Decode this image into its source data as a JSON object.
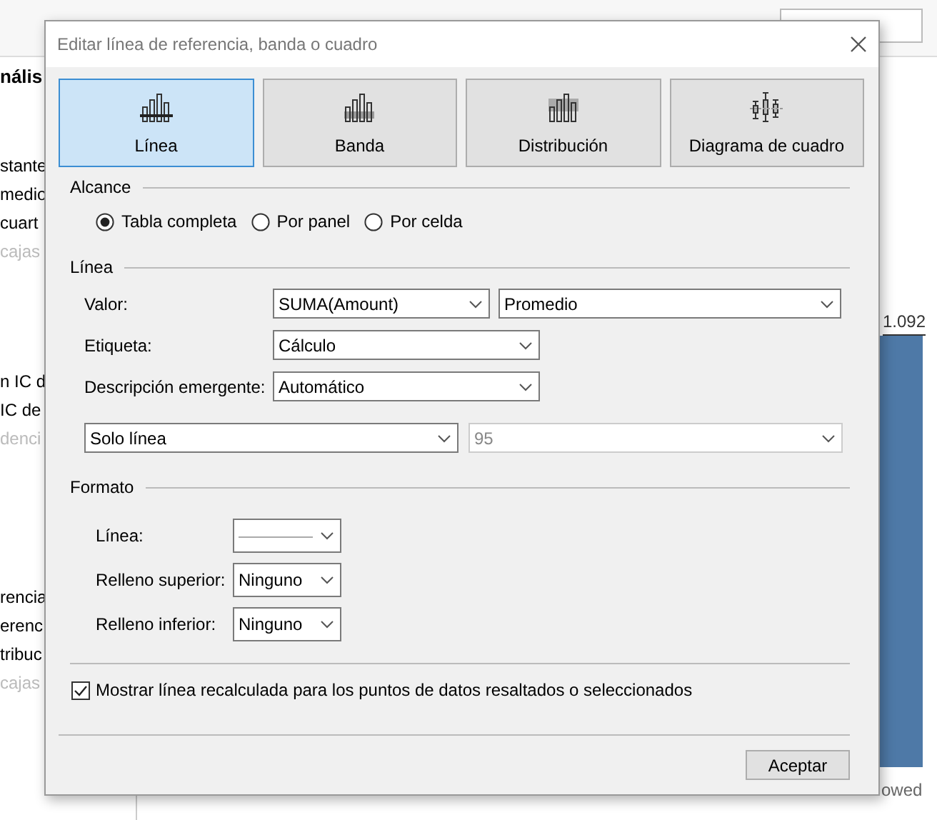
{
  "background": {
    "sidebar_groups": [
      [
        {
          "text": "nális",
          "kind": "heading"
        }
      ],
      [
        {
          "text": "stante",
          "kind": "normal"
        },
        {
          "text": "medio",
          "kind": "normal"
        },
        {
          "text": "cuart",
          "kind": "normal"
        },
        {
          "text": "cajas",
          "kind": "muted"
        }
      ],
      [
        {
          "text": "n IC d",
          "kind": "normal"
        },
        {
          "text": "IC de",
          "kind": "normal"
        },
        {
          "text": "denci",
          "kind": "muted"
        }
      ],
      [
        {
          "text": "rencia",
          "kind": "normal"
        },
        {
          "text": "erenc",
          "kind": "normal"
        },
        {
          "text": "tribuc",
          "kind": "normal"
        },
        {
          "text": "cajas",
          "kind": "muted"
        }
      ]
    ],
    "chart": {
      "value_label": "1.092",
      "axis_label": "owed"
    }
  },
  "dialog": {
    "title": "Editar línea de referencia, banda o cuadro",
    "tabs": [
      {
        "label": "Línea",
        "kind": "line",
        "selected": true
      },
      {
        "label": "Banda",
        "kind": "band",
        "selected": false
      },
      {
        "label": "Distribución",
        "kind": "distribution",
        "selected": false
      },
      {
        "label": "Diagrama de cuadro",
        "kind": "boxplot",
        "selected": false
      }
    ],
    "scope": {
      "heading": "Alcance",
      "options": [
        {
          "label": "Tabla completa",
          "selected": true
        },
        {
          "label": "Por panel",
          "selected": false
        },
        {
          "label": "Por celda",
          "selected": false
        }
      ]
    },
    "line": {
      "heading": "Línea",
      "fields": [
        {
          "label": "Valor:",
          "value": "SUMA(Amount)",
          "aggregation": "Promedio"
        },
        {
          "label": "Etiqueta:",
          "value": "Cálculo"
        },
        {
          "label": "Descripción emergente:",
          "value": "Automático"
        }
      ],
      "display": {
        "value": "Solo línea"
      },
      "confidence": {
        "value": "95",
        "disabled": true
      }
    },
    "format": {
      "heading": "Formato",
      "fields": [
        {
          "label": "Línea:",
          "kind": "line-sample"
        },
        {
          "label": "Relleno superior:",
          "kind": "text",
          "value": "Ninguno"
        },
        {
          "label": "Relleno inferior:",
          "kind": "text",
          "value": "Ninguno"
        }
      ]
    },
    "recalc": {
      "label": "Mostrar línea recalculada para los puntos de datos resaltados o seleccionados",
      "checked": true
    },
    "buttons": [
      "Aceptar"
    ]
  }
}
